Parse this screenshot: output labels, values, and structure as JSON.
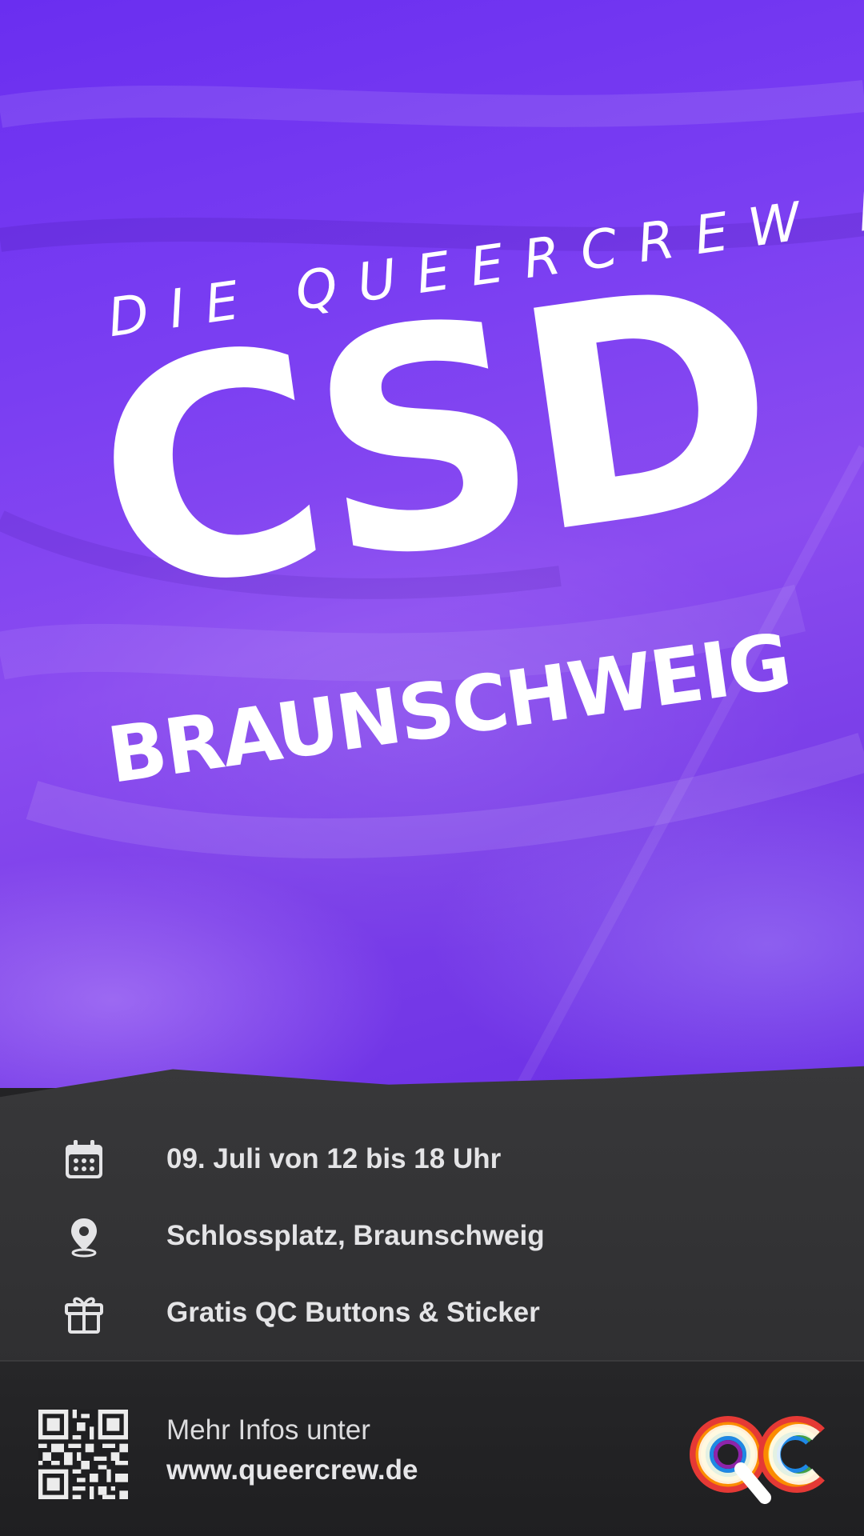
{
  "hero": {
    "subtitle": "DIE QUEERCREW BEIM",
    "title": "CSD",
    "city": "BRAUNSCHWEIG"
  },
  "info": {
    "items": [
      {
        "icon": "calendar-icon",
        "text": "09. Juli von 12 bis 18 Uhr"
      },
      {
        "icon": "location-pin-icon",
        "text": "Schlossplatz, Braunschweig"
      },
      {
        "icon": "gift-icon",
        "text": "Gratis QC Buttons & Sticker"
      }
    ]
  },
  "footer": {
    "more_info": "Mehr Infos unter",
    "website": "www.queercrew.de",
    "logo_icon": "qc-rainbow-logo"
  },
  "colors": {
    "purple": "#7a3ef2",
    "dark": "#2f2f31",
    "text_light": "#e4e4e6",
    "white": "#ffffff"
  }
}
